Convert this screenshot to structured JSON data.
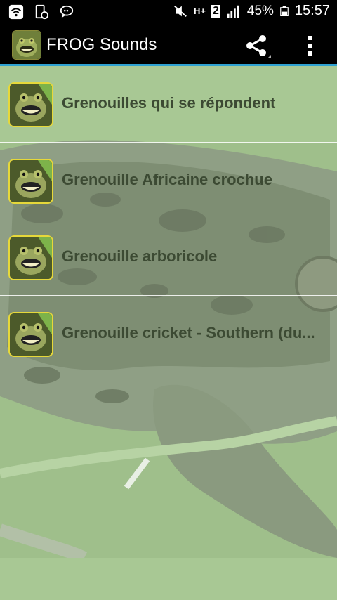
{
  "status_bar": {
    "battery": "45%",
    "time": "15:57",
    "network": "H+",
    "sim": "2",
    "icons": [
      "wifi-icon",
      "device-notification-icon",
      "chat-bubble-icon",
      "mute-icon",
      "signal-icon",
      "battery-icon"
    ]
  },
  "action_bar": {
    "title": "FROG Sounds",
    "icons": [
      "app-logo-icon",
      "share-icon",
      "overflow-menu-icon"
    ]
  },
  "list": {
    "items": [
      {
        "label": "Grenouilles qui se répondent"
      },
      {
        "label": "Grenouille Africaine crochue"
      },
      {
        "label": "Grenouille arboricole"
      },
      {
        "label": "Grenouille cricket - Southern (du..."
      }
    ]
  },
  "colors": {
    "accent": "#2ea1d1",
    "list_text": "#3c4a33",
    "thumb_border": "#e6d83a",
    "background_green": "#a9c596"
  }
}
